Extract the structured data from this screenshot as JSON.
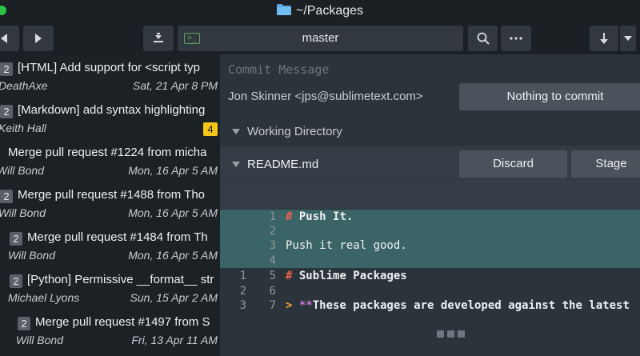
{
  "window": {
    "title": "~/Packages"
  },
  "toolbar": {
    "branch": "master"
  },
  "commits": [
    {
      "badge": "2",
      "message": "[HTML] Add support for <script typ",
      "author": "DeathAxe",
      "date": "Sat, 21 Apr 8 PM"
    },
    {
      "badge": "2",
      "message": "[Markdown] add syntax highlighting",
      "author": "Keith Hall",
      "count": "4"
    },
    {
      "badge": "",
      "message": "Merge pull request #1224 from micha",
      "author": "Will Bond",
      "date": "Mon, 16 Apr 5 AM"
    },
    {
      "badge": "2",
      "message": "Merge pull request #1488 from Tho",
      "author": "Will Bond",
      "date": "Mon, 16 Apr 5 AM"
    },
    {
      "badge": "2",
      "message": "Merge pull request #1484 from Th",
      "author": "Will Bond",
      "date": "Mon, 16 Apr 5 AM"
    },
    {
      "badge": "2",
      "message": "[Python] Permissive __format__ str",
      "author": "Michael Lyons",
      "date": "Sun, 15 Apr 2 AM"
    },
    {
      "badge": "2",
      "message": "Merge pull request #1497 from S",
      "author": "Will Bond",
      "date": "Fri, 13 Apr 11 AM"
    }
  ],
  "commit_panel": {
    "placeholder": "Commit Message",
    "author_line": "Jon Skinner <jps@sublimetext.com>",
    "commit_button": "Nothing to commit",
    "working_directory": "Working Directory"
  },
  "file": {
    "name": "README.md",
    "discard_label": "Discard",
    "stage_label": "Stage"
  },
  "diff_lines": [
    {
      "old": "",
      "new": "1",
      "hash": "#",
      "text": " Push It.",
      "added": true
    },
    {
      "old": "",
      "new": "2",
      "hash": "",
      "text": "",
      "added": true
    },
    {
      "old": "",
      "new": "3",
      "hash": "",
      "text": "Push it real good.",
      "added": true
    },
    {
      "old": "",
      "new": "4",
      "hash": "",
      "text": "",
      "added": true
    },
    {
      "old": "1",
      "new": "5",
      "hash": "#",
      "text": " Sublime Packages",
      "added": false
    },
    {
      "old": "2",
      "new": "6",
      "hash": "",
      "text": "",
      "added": false
    },
    {
      "old": "3",
      "new": "7",
      "hash": "",
      "text": "These packages are developed against the latest",
      "added": false,
      "quote": true
    }
  ],
  "colors": {
    "accent_added": "#3b6466",
    "badge_yellow": "#f5c518",
    "heading_hash": "#f4604a"
  }
}
